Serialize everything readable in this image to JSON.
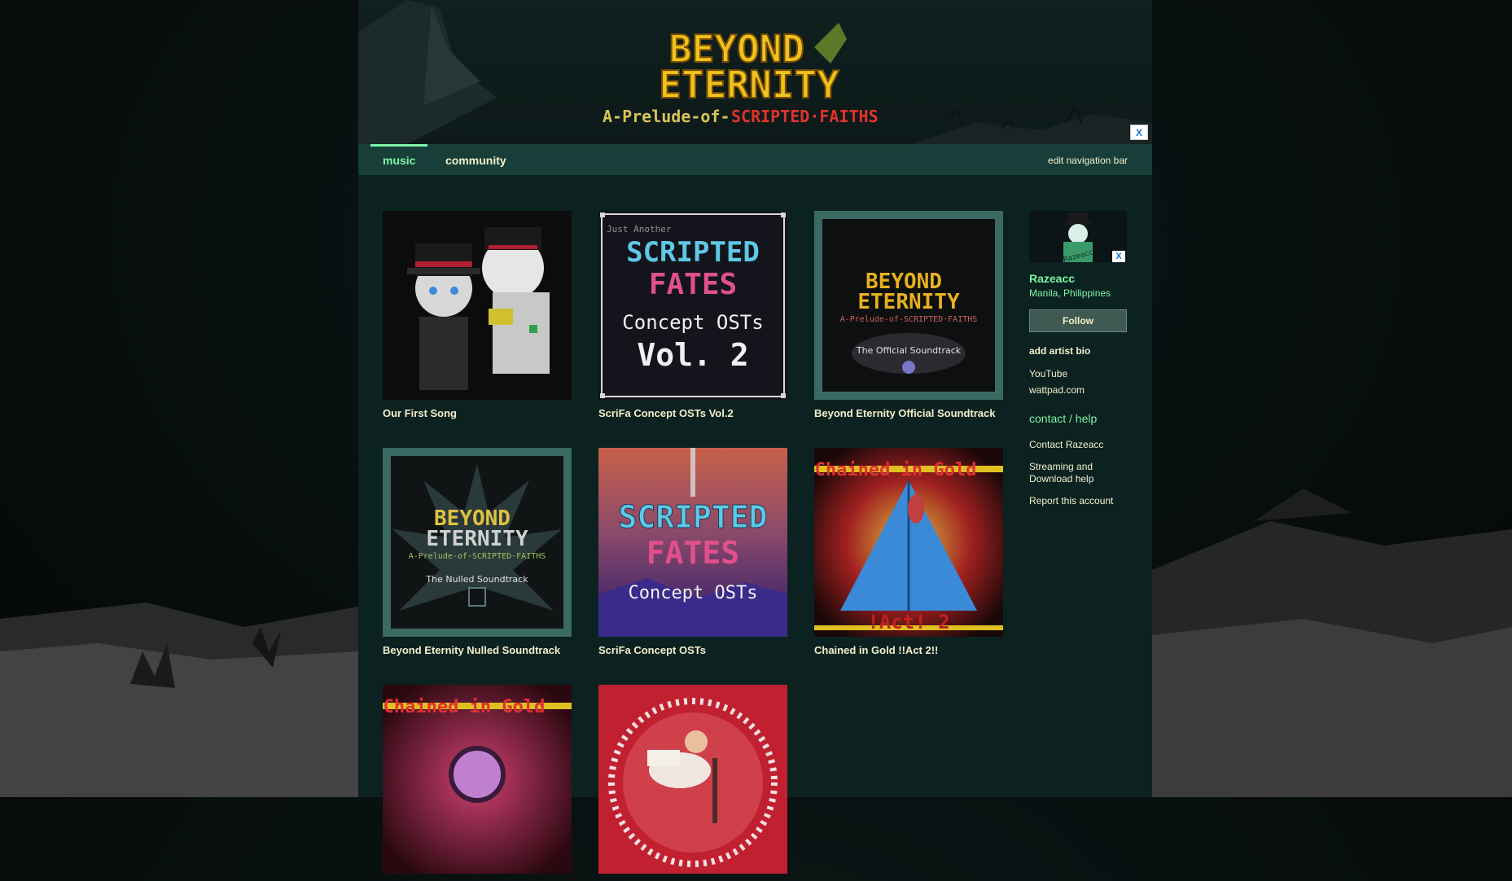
{
  "banner": {
    "close_label": "X",
    "logo_line1": "BEYOND",
    "logo_line2": "ETERNITY",
    "logo_sub_a": "A-Prelude-of-",
    "logo_sub_b": "SCRIPTED·FAITHS"
  },
  "nav": {
    "tabs": [
      {
        "label": "music",
        "active": true
      },
      {
        "label": "community",
        "active": false
      }
    ],
    "edit_label": "edit navigation bar"
  },
  "albums": [
    {
      "title": "Our First Song"
    },
    {
      "title": "ScriFa Concept OSTs Vol.2",
      "art_top": "Just Another",
      "art_l1": "SCRIPTED",
      "art_l2": "FATES",
      "art_l3": "Concept OSTs",
      "art_l4": "Vol. 2"
    },
    {
      "title": "Beyond Eternity Official Soundtrack",
      "art_l1": "BEYOND",
      "art_l2": "ETERNITY",
      "art_l3": "A-Prelude-of-SCRIPTED·FAITHS",
      "art_l4": "The Official Soundtrack"
    },
    {
      "title": "Beyond Eternity Nulled Soundtrack",
      "art_l1": "BEYOND",
      "art_l2": "ETERNITY",
      "art_l3": "A-Prelude-of-SCRIPTED·FAITHS",
      "art_l4": "The Nulled Soundtrack"
    },
    {
      "title": "ScriFa Concept OSTs",
      "art_l1": "SCRIPTED",
      "art_l2": "FATES",
      "art_l3": "Concept OSTs"
    },
    {
      "title": "Chained in Gold !!Act 2!!",
      "art_l1": "Chained in Gold",
      "art_l2": "!Act! 2"
    },
    {
      "title": "",
      "art_l1": "Chained in Gold"
    },
    {
      "title": ""
    }
  ],
  "sidebar": {
    "avatar_close": "X",
    "avatar_text": "Razeacc",
    "artist_name": "Razeacc",
    "location": "Manila, Philippines",
    "follow_label": "Follow",
    "add_bio": "add artist bio",
    "links": [
      "YouTube",
      "wattpad.com"
    ],
    "contact_heading": "contact / help",
    "contact_links": [
      "Contact Razeacc",
      "Streaming and\nDownload help",
      "Report this account"
    ]
  },
  "colors": {
    "accent": "#7ff5a8",
    "text": "#f2f0cc",
    "page_bg": "#0b2220",
    "nav_bg": "#173e38"
  }
}
